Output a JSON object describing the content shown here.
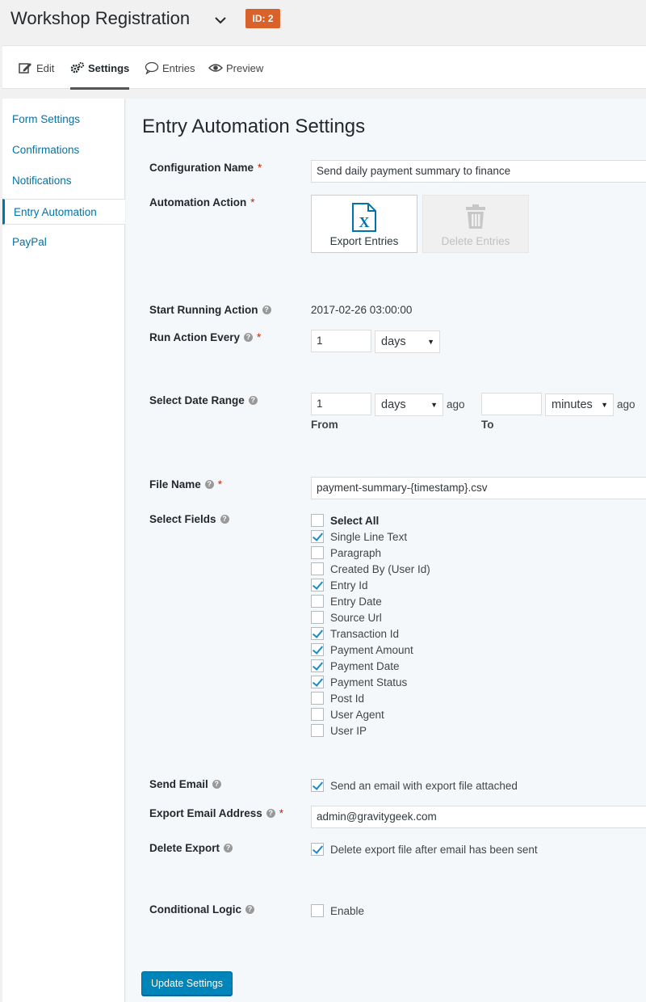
{
  "header": {
    "form_title": "Workshop Registration",
    "id_badge": "ID: 2",
    "badge_color": "#d9622b"
  },
  "tabs": [
    {
      "label": "Edit",
      "icon": "edit-icon"
    },
    {
      "label": "Settings",
      "icon": "gear-icon",
      "active": true
    },
    {
      "label": "Entries",
      "icon": "speech-bubble-icon"
    },
    {
      "label": "Preview",
      "icon": "eye-icon"
    }
  ],
  "sidebar": {
    "items": [
      {
        "label": "Form Settings"
      },
      {
        "label": "Confirmations"
      },
      {
        "label": "Notifications"
      },
      {
        "label": "Entry Automation",
        "active": true
      },
      {
        "label": "PayPal"
      }
    ]
  },
  "main": {
    "title": "Entry Automation Settings",
    "configuration_name": {
      "label": "Configuration Name",
      "value": "Send daily payment summary to finance"
    },
    "automation_action": {
      "label": "Automation Action",
      "options": [
        {
          "label": "Export Entries",
          "icon": "excel-file-icon",
          "selected": true
        },
        {
          "label": "Delete Entries",
          "icon": "trash-icon",
          "disabled": true
        }
      ]
    },
    "start_running": {
      "label": "Start Running Action",
      "value": "2017-02-26 03:00:00"
    },
    "run_every": {
      "label": "Run Action Every",
      "value": "1",
      "unit": "days"
    },
    "date_range": {
      "label": "Select Date Range",
      "from_value": "1",
      "from_unit": "days",
      "from_ago": "ago",
      "from_label": "From",
      "to_value": "",
      "to_unit": "minutes",
      "to_ago": "ago",
      "to_label": "To"
    },
    "file_name": {
      "label": "File Name",
      "value": "payment-summary-{timestamp}.csv"
    },
    "select_fields": {
      "label": "Select Fields",
      "fields": [
        {
          "label": "Select All",
          "checked": false
        },
        {
          "label": "Single Line Text",
          "checked": true
        },
        {
          "label": "Paragraph",
          "checked": false
        },
        {
          "label": "Created By (User Id)",
          "checked": false
        },
        {
          "label": "Entry Id",
          "checked": true
        },
        {
          "label": "Entry Date",
          "checked": false
        },
        {
          "label": "Source Url",
          "checked": false
        },
        {
          "label": "Transaction Id",
          "checked": true
        },
        {
          "label": "Payment Amount",
          "checked": true
        },
        {
          "label": "Payment Date",
          "checked": true
        },
        {
          "label": "Payment Status",
          "checked": true
        },
        {
          "label": "Post Id",
          "checked": false
        },
        {
          "label": "User Agent",
          "checked": false
        },
        {
          "label": "User IP",
          "checked": false
        }
      ]
    },
    "send_email": {
      "label": "Send Email",
      "option": "Send an email with export file attached",
      "checked": true
    },
    "export_email": {
      "label": "Export Email Address",
      "value": "admin@gravitygeek.com"
    },
    "delete_export": {
      "label": "Delete Export",
      "option": "Delete export file after email has been sent",
      "checked": true
    },
    "conditional_logic": {
      "label": "Conditional Logic",
      "option": "Enable",
      "checked": false
    },
    "update_button": "Update Settings"
  }
}
